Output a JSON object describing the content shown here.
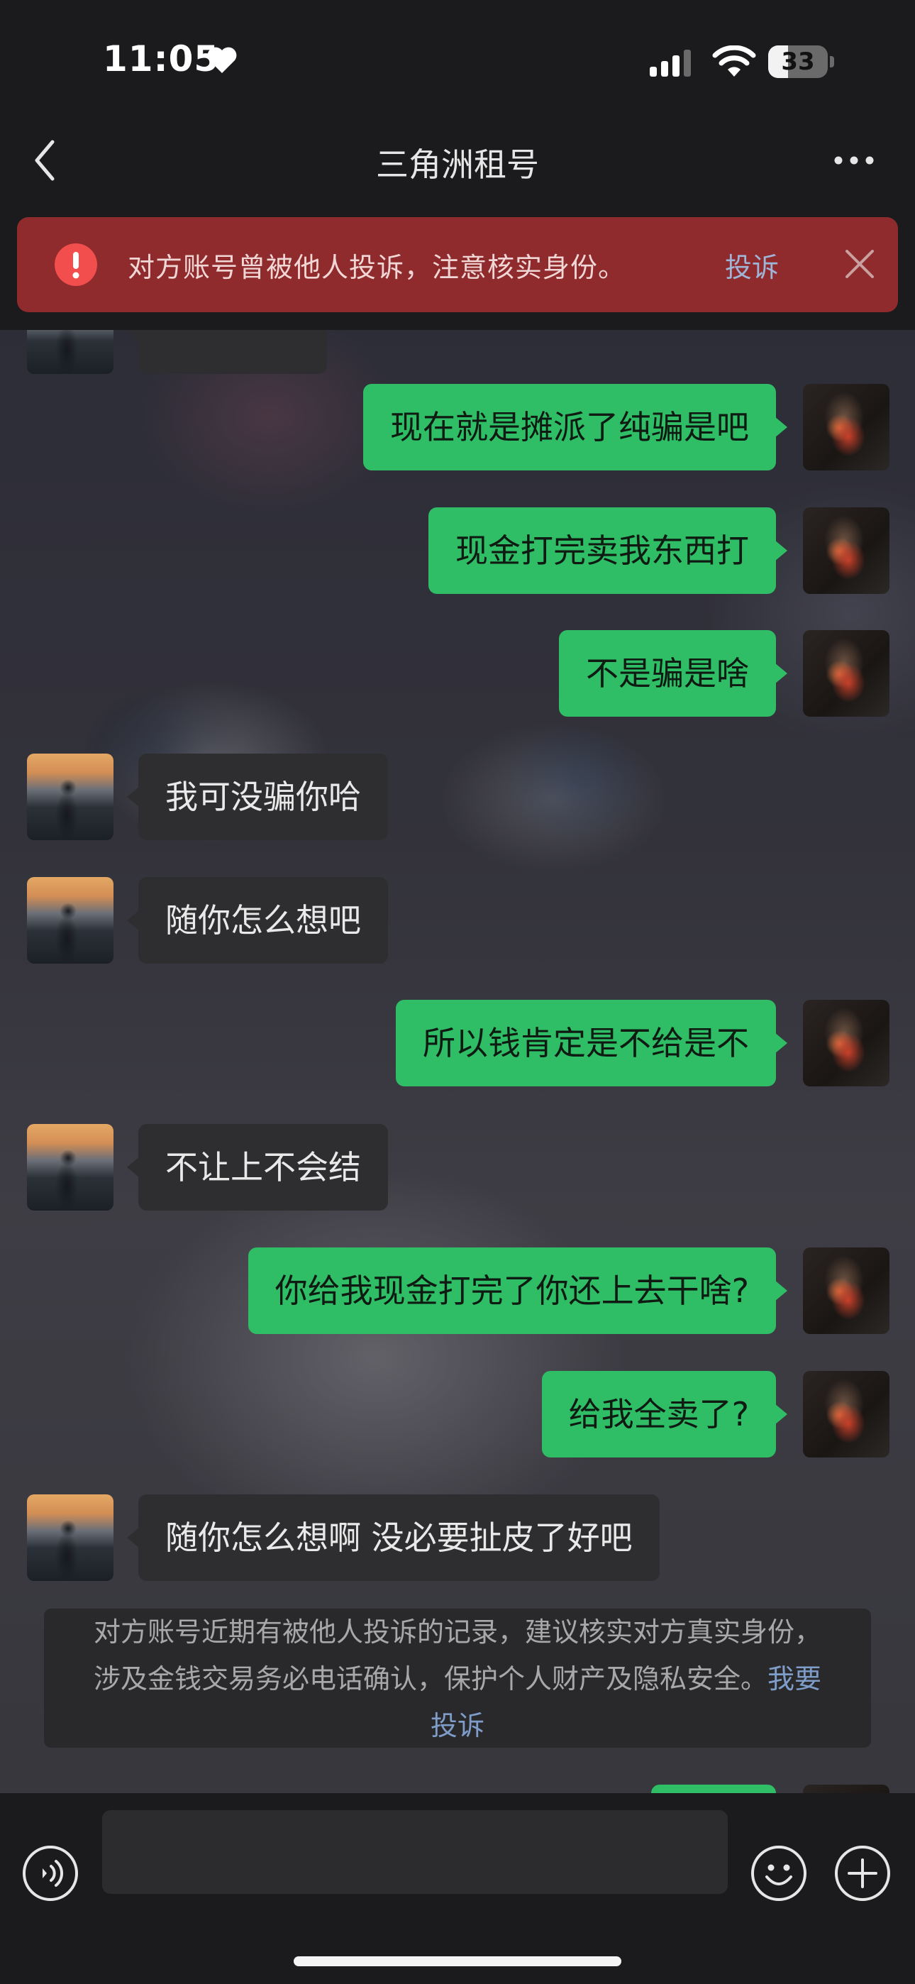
{
  "status_bar": {
    "time": "11:05",
    "battery": "33",
    "battery_level": 0.33
  },
  "header": {
    "title": "三角洲租号"
  },
  "warning": {
    "text": "对方账号曾被他人投诉，注意核实身份。",
    "link": "投诉"
  },
  "messages": [
    {
      "from": "me",
      "text": "现在就是摊派了纯骗是吧"
    },
    {
      "from": "me",
      "text": "现金打完卖我东西打"
    },
    {
      "from": "me",
      "text": "不是骗是啥"
    },
    {
      "from": "other",
      "text": "我可没骗你哈"
    },
    {
      "from": "other",
      "text": "随你怎么想吧"
    },
    {
      "from": "me",
      "text": "所以钱肯定是不给是不"
    },
    {
      "from": "other",
      "text": "不让上不会结"
    },
    {
      "from": "me",
      "text": "你给我现金打完了你还上去干啥?"
    },
    {
      "from": "me",
      "text": "给我全卖了?"
    },
    {
      "from": "other",
      "text": "随你怎么想啊 没必要扯皮了好吧"
    }
  ],
  "system_notice": {
    "line1": "对方账号近期有被他人投诉的记录，建议核实对方真实身份，",
    "line2": "涉及金钱交易务必电话确认，保护个人财产及隐私安全。",
    "link_part1": "我要",
    "link_part2": "投诉"
  },
  "input": {
    "value": "",
    "placeholder": ""
  },
  "colors": {
    "my_bubble": "#2fbd65",
    "other_bubble": "#2e2e30",
    "warning_bg": "#8f2b2d",
    "link": "#7f9dc9"
  }
}
